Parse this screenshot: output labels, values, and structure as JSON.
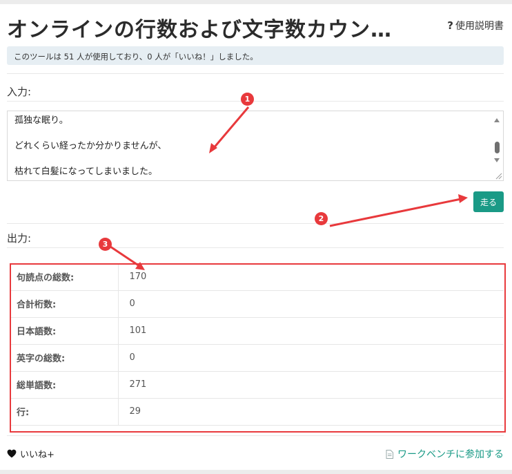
{
  "header": {
    "title": "オンラインの行数および文字数カウン…",
    "help_label": "使用説明書"
  },
  "notice": {
    "text": "このツールは 51 人が使用しており、0 人が「いいね！」しました。"
  },
  "input_section": {
    "label": "入力:",
    "lines": [
      "孤独な眠り。",
      "",
      "どれくらい経ったか分かりませんが、",
      "",
      "枯れて白髪になってしまいました。"
    ]
  },
  "run_button": {
    "label": "走る"
  },
  "output_section": {
    "label": "出力:",
    "rows": [
      {
        "key": "句読点の総数:",
        "value": "170"
      },
      {
        "key": "合計桁数:",
        "value": "0"
      },
      {
        "key": "日本語数:",
        "value": "101"
      },
      {
        "key": "英字の総数:",
        "value": "0"
      },
      {
        "key": "総単語数:",
        "value": "271"
      },
      {
        "key": "行:",
        "value": "29"
      }
    ]
  },
  "footer": {
    "like_label": "いいね+",
    "workbench_label": "ワークベンチに参加する"
  },
  "annotations": {
    "badges": [
      "1",
      "2",
      "3"
    ],
    "color": "#e8393c"
  },
  "colors": {
    "accent": "#1a9a86",
    "notice_bg": "#e6eef3"
  }
}
